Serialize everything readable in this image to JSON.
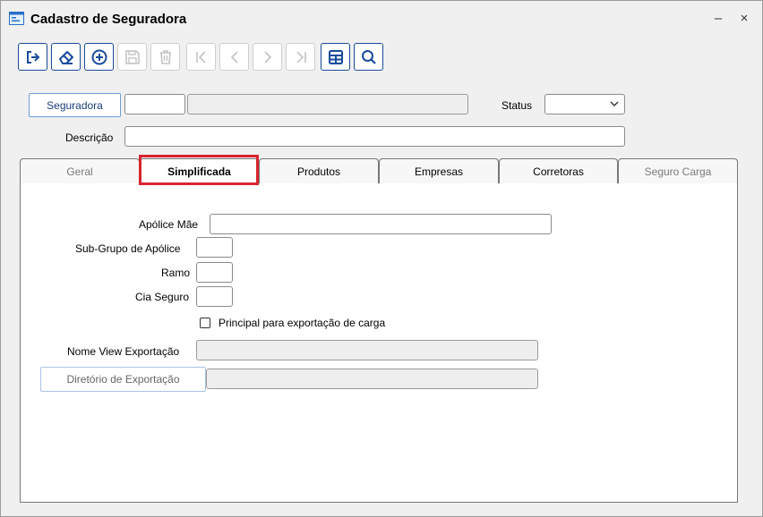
{
  "window": {
    "title": "Cadastro de Seguradora",
    "minimize": "–",
    "close": "×"
  },
  "toolbar": {
    "buttons": [
      {
        "name": "exit-icon",
        "enabled": true
      },
      {
        "name": "eraser-icon",
        "enabled": true
      },
      {
        "name": "add-icon",
        "enabled": true
      },
      {
        "name": "save-icon",
        "enabled": false
      },
      {
        "name": "trash-icon",
        "enabled": false
      },
      {
        "name": "first-record-icon",
        "enabled": false
      },
      {
        "name": "previous-record-icon",
        "enabled": false
      },
      {
        "name": "next-record-icon",
        "enabled": false
      },
      {
        "name": "last-record-icon",
        "enabled": false
      },
      {
        "name": "table-icon",
        "enabled": true
      },
      {
        "name": "search-icon",
        "enabled": true
      }
    ]
  },
  "header": {
    "seguradora_button": "Seguradora",
    "seguradora_code": "",
    "seguradora_name": "",
    "status_label": "Status",
    "status_value": "",
    "descricao_label": "Descrição",
    "descricao_value": ""
  },
  "tabs": [
    {
      "label": "Geral",
      "state": "disabled"
    },
    {
      "label": "Simplificada",
      "state": "active"
    },
    {
      "label": "Produtos",
      "state": "normal"
    },
    {
      "label": "Empresas",
      "state": "normal"
    },
    {
      "label": "Corretoras",
      "state": "normal"
    },
    {
      "label": "Seguro Carga",
      "state": "disabled"
    }
  ],
  "simplificada": {
    "apolice_mae_label": "Apólice Mãe",
    "apolice_mae_value": "",
    "subgrupo_label": "Sub-Grupo de Apólice",
    "subgrupo_value": "",
    "ramo_label": "Ramo",
    "ramo_value": "",
    "cia_seguro_label": "Cia Seguro",
    "cia_seguro_value": "",
    "principal_checkbox_label": "Principal para exportação de carga",
    "principal_checked": false,
    "nome_view_label": "Nome View Exportação",
    "nome_view_value": "",
    "diretorio_button": "Diretório de Exportação",
    "diretorio_value": ""
  },
  "colors": {
    "toolbar_border": "#1a4b9c",
    "highlight": "#d8252f"
  }
}
